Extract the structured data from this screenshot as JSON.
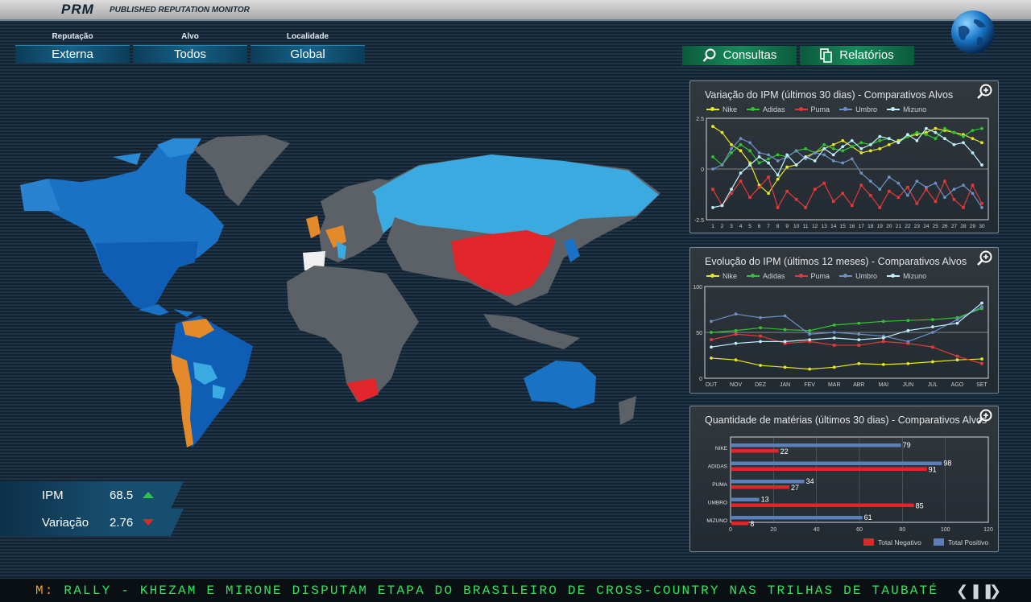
{
  "header": {
    "logo": "PRM",
    "title": "PUBLISHED REPUTATION MONITOR",
    "globe_icon": "globe-icon"
  },
  "filters": [
    {
      "label": "Reputação",
      "value": "Externa"
    },
    {
      "label": "Alvo",
      "value": "Todos"
    },
    {
      "label": "Localidade",
      "value": "Global"
    }
  ],
  "actions": {
    "consultas": "Consultas",
    "relatorios": "Relatórios"
  },
  "stats": {
    "ipm_label": "IPM",
    "ipm_value": "68.5",
    "ipm_trend": "up",
    "var_label": "Variação",
    "var_value": "2.76",
    "var_trend": "down"
  },
  "colors": {
    "up": "#2fbf4a",
    "down": "#e0262a",
    "nike": "#e8e820",
    "adidas": "#33c333",
    "puma": "#e23a3a",
    "umbro": "#6d8fc4",
    "mizuno": "#bfefff"
  },
  "ticker": {
    "prefix": "M:",
    "text": "RALLY - KHEZAM E MIRONE DISPUTAM ETAPA DO BRASILEIRO DE CROSS-COUNTRY NAS TRILHAS DE TAUBATÉ"
  },
  "panels": {
    "p1_title": "Variação do IPM (últimos 30 dias) - Comparativos Alvos",
    "p2_title": "Evolução do IPM (últimos 12 meses) - Comparativos Alvos",
    "p3_title": "Quantidade de matérias (últimos 30 dias) - Comparativos Alvos"
  },
  "legend_names": [
    "Nike",
    "Adidas",
    "Puma",
    "Umbro",
    "Mizuno"
  ],
  "chart_data": [
    {
      "type": "line",
      "title": "Variação do IPM (últimos 30 dias) - Comparativos Alvos",
      "x": [
        1,
        2,
        3,
        4,
        5,
        6,
        7,
        8,
        9,
        10,
        11,
        12,
        13,
        14,
        15,
        16,
        17,
        18,
        19,
        20,
        21,
        22,
        23,
        24,
        25,
        26,
        27,
        28,
        29,
        30
      ],
      "ylim": [
        -2.5,
        2.5
      ],
      "yticks": [
        "2.5",
        "0",
        "-2.5"
      ],
      "series": [
        {
          "name": "Nike",
          "values": [
            2.1,
            1.8,
            1.2,
            0.9,
            0.3,
            -0.8,
            -1.2,
            -0.5,
            0.1,
            0.2,
            0.6,
            0.8,
            1.0,
            1.2,
            1.4,
            1.1,
            0.8,
            0.9,
            1.0,
            1.2,
            1.4,
            1.6,
            1.7,
            1.8,
            2.0,
            1.9,
            1.8,
            1.7,
            1.5,
            1.3
          ]
        },
        {
          "name": "Adidas",
          "values": [
            0.6,
            0.2,
            0.8,
            1.2,
            0.9,
            0.3,
            0.5,
            0.7,
            0.6,
            0.9,
            1.0,
            0.8,
            1.2,
            1.0,
            0.9,
            1.1,
            1.3,
            1.2,
            1.4,
            1.5,
            1.3,
            1.6,
            1.8,
            1.7,
            1.5,
            2.0,
            1.8,
            1.6,
            1.9,
            2.0
          ]
        },
        {
          "name": "Puma",
          "values": [
            -1.0,
            -1.8,
            -1.2,
            -0.6,
            -1.4,
            -0.9,
            -0.4,
            -1.9,
            -1.1,
            -1.5,
            -1.9,
            -1.0,
            -0.7,
            -1.6,
            -1.2,
            -1.8,
            -0.8,
            -1.3,
            -1.9,
            -1.1,
            -1.4,
            -0.9,
            -1.7,
            -1.0,
            -1.6,
            -0.6,
            -1.5,
            -1.9,
            -0.8,
            -1.7
          ]
        },
        {
          "name": "Umbro",
          "values": [
            0.0,
            0.2,
            1.0,
            1.5,
            1.3,
            0.8,
            0.7,
            0.4,
            0.6,
            0.9,
            0.5,
            0.8,
            0.7,
            0.4,
            0.3,
            0.5,
            -0.2,
            -0.6,
            -1.0,
            -0.4,
            -0.7,
            -1.3,
            -0.6,
            -0.9,
            -0.7,
            -1.4,
            -1.0,
            -0.8,
            -1.2,
            -1.9
          ]
        },
        {
          "name": "Mizuno",
          "values": [
            -1.9,
            -1.8,
            -1.0,
            -0.2,
            0.2,
            0.6,
            0.3,
            -0.3,
            0.7,
            0.2,
            0.6,
            0.4,
            1.0,
            0.7,
            1.1,
            1.4,
            1.0,
            1.2,
            1.6,
            1.5,
            1.3,
            1.7,
            1.4,
            2.0,
            1.8,
            1.5,
            1.2,
            1.3,
            0.8,
            0.2
          ]
        }
      ]
    },
    {
      "type": "line",
      "title": "Evolução do IPM (últimos 12 meses) - Comparativos Alvos",
      "categories": [
        "OUT",
        "NOV",
        "DEZ",
        "JAN",
        "FEV",
        "MAR",
        "ABR",
        "MAI",
        "JUN",
        "JUL",
        "AGO",
        "SET"
      ],
      "ylim": [
        0,
        100
      ],
      "yticks": [
        "100",
        "50",
        "0"
      ],
      "series": [
        {
          "name": "Nike",
          "values": [
            22,
            20,
            14,
            12,
            10,
            12,
            16,
            15,
            16,
            18,
            20,
            21
          ]
        },
        {
          "name": "Adidas",
          "values": [
            50,
            52,
            55,
            53,
            52,
            58,
            60,
            62,
            63,
            64,
            66,
            76
          ]
        },
        {
          "name": "Puma",
          "values": [
            42,
            48,
            46,
            38,
            40,
            36,
            36,
            40,
            38,
            34,
            24,
            16
          ]
        },
        {
          "name": "Umbro",
          "values": [
            62,
            70,
            66,
            68,
            48,
            50,
            48,
            46,
            40,
            50,
            64,
            78
          ]
        },
        {
          "name": "Mizuno",
          "values": [
            34,
            38,
            40,
            40,
            42,
            44,
            42,
            44,
            52,
            56,
            60,
            82
          ]
        }
      ]
    },
    {
      "type": "bar",
      "orientation": "horizontal",
      "title": "Quantidade de matérias (últimos 30 dias) - Comparativos Alvos",
      "categories": [
        "NIKE",
        "ADIDAS",
        "PUMA",
        "UMBRO",
        "MIZUNO"
      ],
      "xlim": [
        0,
        120
      ],
      "xticks": [
        "0",
        "20",
        "40",
        "60",
        "80",
        "100",
        "120"
      ],
      "series": [
        {
          "name": "Total Positivo",
          "values": [
            79,
            98,
            34,
            13,
            61
          ]
        },
        {
          "name": "Total Negativo",
          "values": [
            22,
            91,
            27,
            85,
            8
          ]
        }
      ]
    }
  ]
}
